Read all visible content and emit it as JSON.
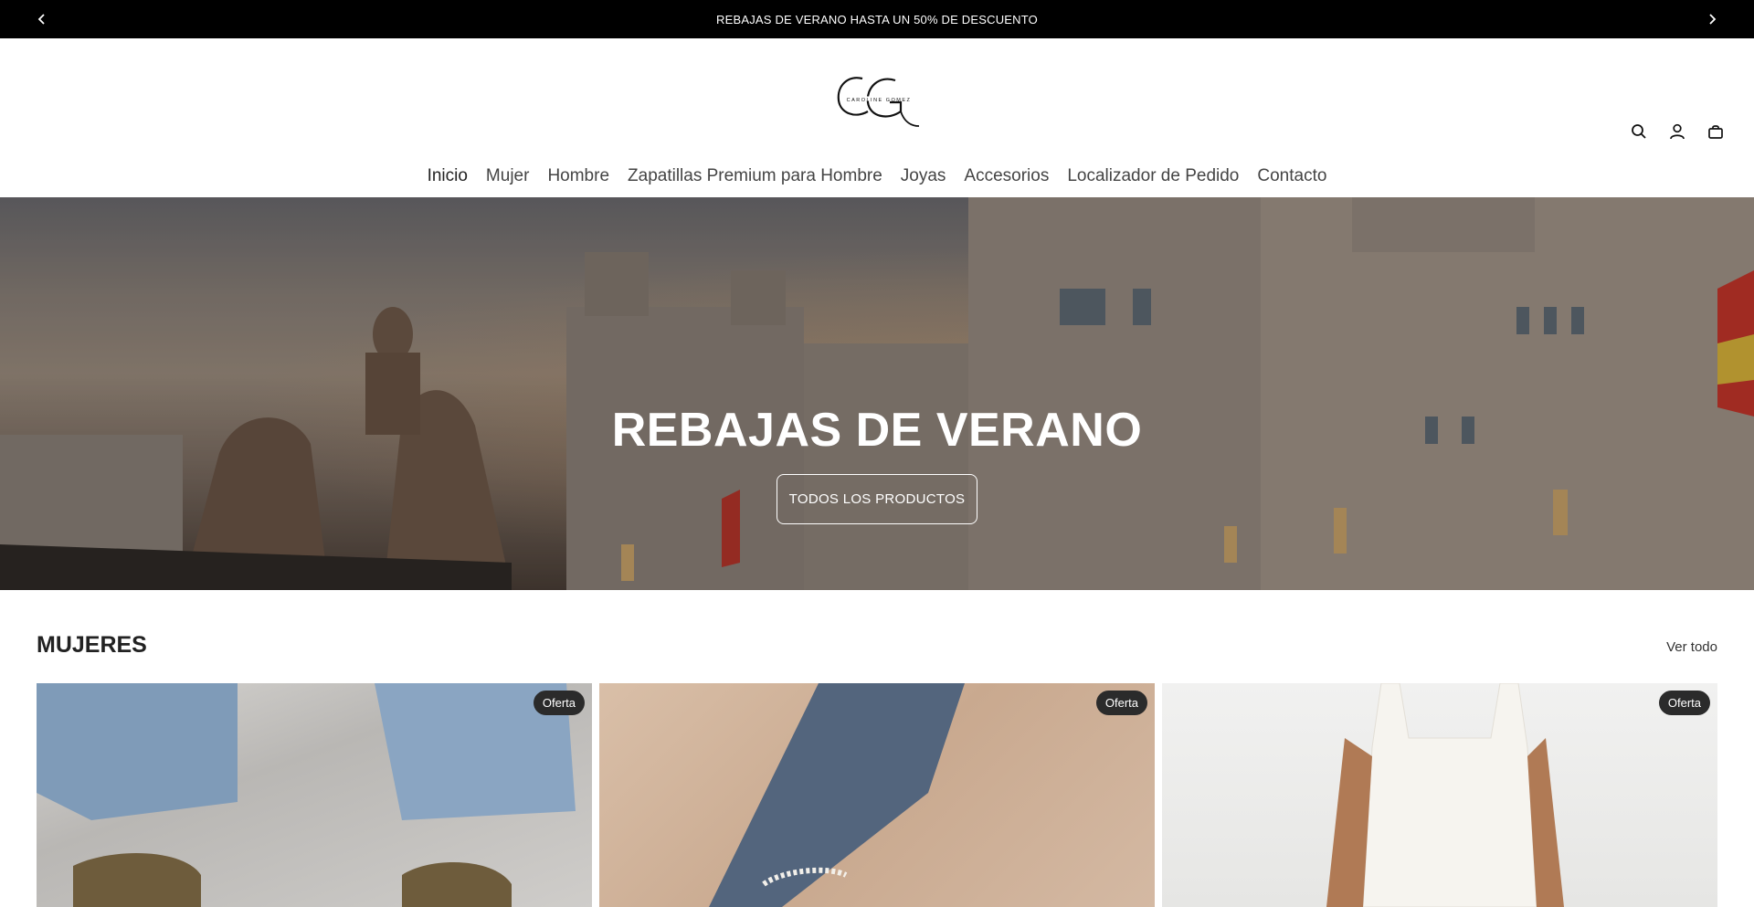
{
  "announcement": {
    "text": "REBAJAS DE VERANO HASTA UN 50% DE DESCUENTO"
  },
  "header": {
    "logo_initials": "CG",
    "logo_tagline": "CAROLINE GOMEZ",
    "icons": [
      "search-icon",
      "account-icon",
      "cart-icon"
    ]
  },
  "nav": {
    "items": [
      "Inicio",
      "Mujer",
      "Hombre",
      "Zapatillas Premium para Hombre",
      "Joyas",
      "Accesorios",
      "Localizador de Pedido",
      "Contacto"
    ]
  },
  "hero": {
    "title": "REBAJAS DE VERANO",
    "button_label": "TODOS LOS PRODUCTOS"
  },
  "section": {
    "title": "MUJERES",
    "view_all": "Ver todo"
  },
  "products": [
    {
      "badge": "Oferta"
    },
    {
      "badge": "Oferta"
    },
    {
      "badge": "Oferta"
    }
  ]
}
